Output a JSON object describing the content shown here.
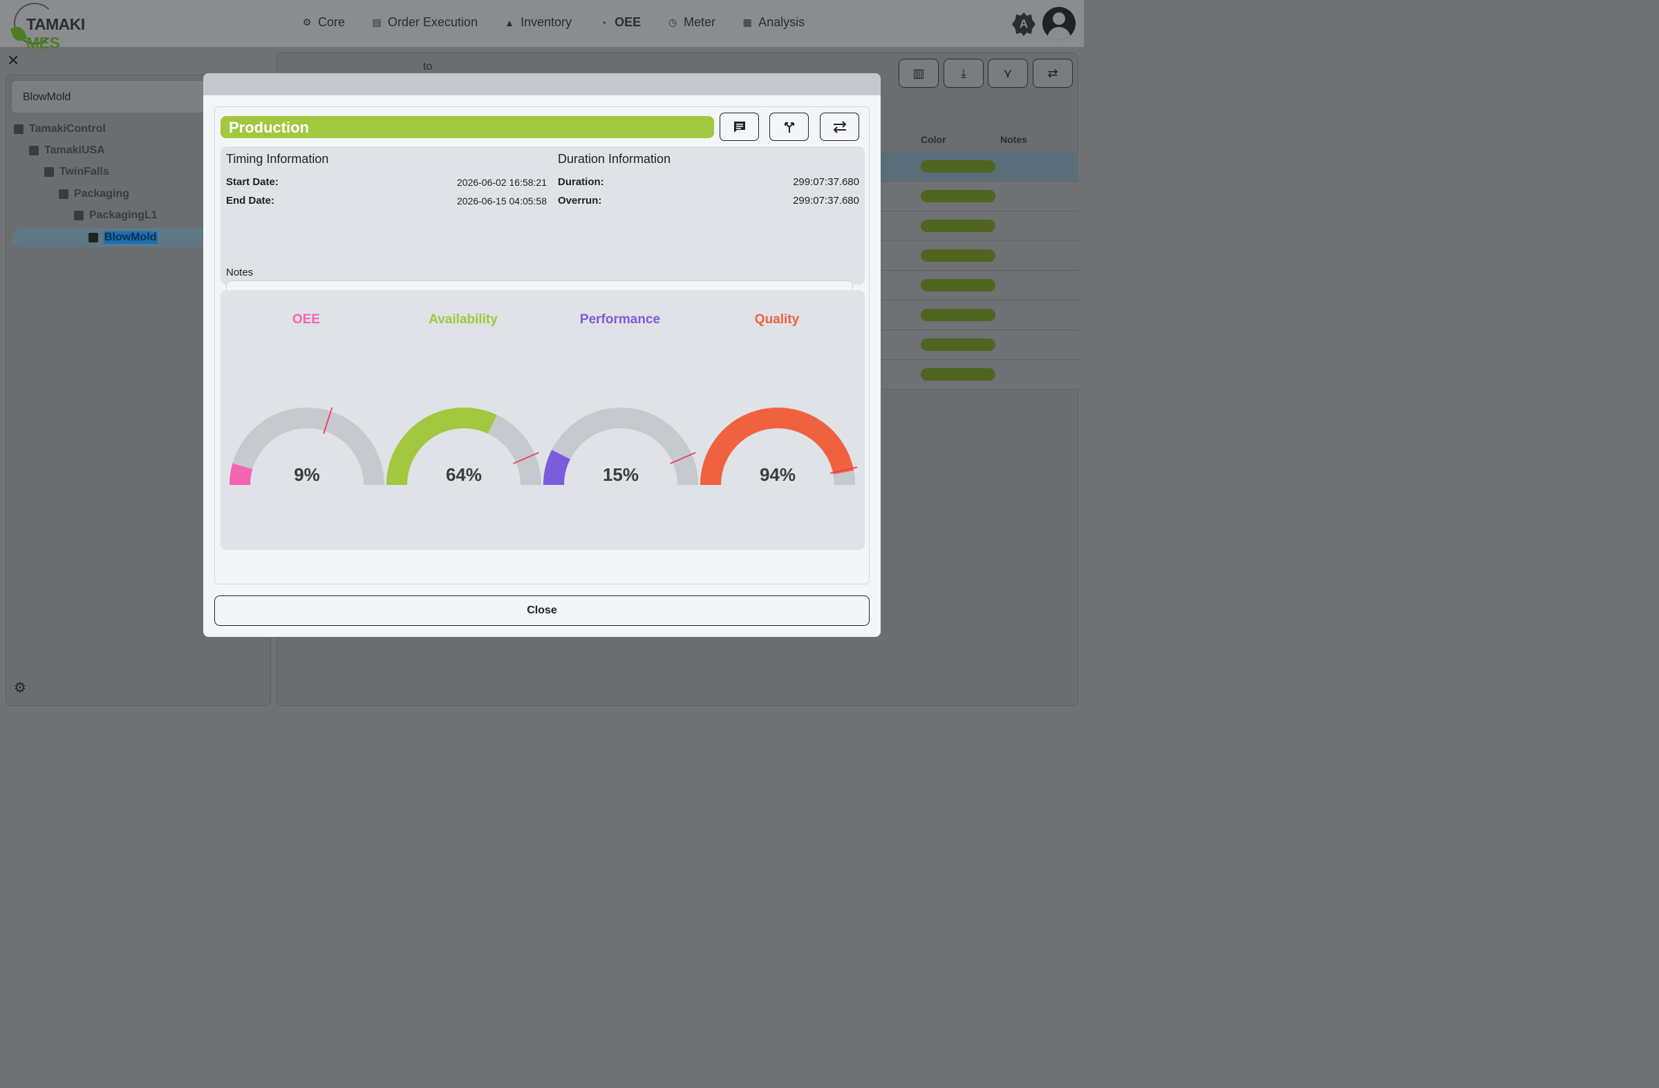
{
  "app": {
    "logo_part1": "TAMAKI",
    "logo_part2": "MES",
    "nav": [
      {
        "label": "Core",
        "icon": "gear-icon"
      },
      {
        "label": "Order Execution",
        "icon": "store-icon"
      },
      {
        "label": "Inventory",
        "icon": "shapes-icon"
      },
      {
        "label": "OEE",
        "icon": "speedometer-icon"
      },
      {
        "label": "Meter",
        "icon": "meter-icon"
      },
      {
        "label": "Analysis",
        "icon": "chart-icon"
      }
    ],
    "theme_label": "A"
  },
  "sidebar": {
    "search_value": "BlowMold",
    "tree": [
      {
        "label": "TamakiControl",
        "icon": "hierarchy-icon"
      },
      {
        "label": "TamakiUSA",
        "icon": "building-icon"
      },
      {
        "label": "TwinFalls",
        "icon": "factory-icon"
      },
      {
        "label": "Packaging",
        "icon": "grid-icon"
      },
      {
        "label": "PackagingL1",
        "icon": "line-icon"
      },
      {
        "label": "BlowMold",
        "icon": "machine-icon",
        "selected": true
      }
    ]
  },
  "background": {
    "to_label": "to",
    "table_headers": {
      "color": "Color",
      "notes": "Notes"
    },
    "row_count": 8,
    "row_pill_color": "#4f6520"
  },
  "modal": {
    "state_label": "Production",
    "state_color": "#a1c83f",
    "timing": {
      "title": "Timing Information",
      "start_label": "Start Date:",
      "start_value": "2026-06-02 16:58:21",
      "end_label": "End Date:",
      "end_value": "2026-06-15 04:05:58"
    },
    "duration": {
      "title": "Duration Information",
      "duration_label": "Duration:",
      "duration_value": "299:07:37.680",
      "overrun_label": "Overrun:",
      "overrun_value": "299:07:37.680"
    },
    "notes_label": "Notes",
    "notes_value": "",
    "close_label": "Close",
    "gauges": [
      {
        "name": "OEE",
        "value": 9,
        "target": 60,
        "color": "#f564b3"
      },
      {
        "name": "Availability",
        "value": 64,
        "target": 87,
        "color": "#a1c83f"
      },
      {
        "name": "Performance",
        "value": 15,
        "target": 87,
        "color": "#7b5cdc"
      },
      {
        "name": "Quality",
        "value": 94,
        "target": 93,
        "color": "#f0623f"
      }
    ],
    "track_color": "#c6c9ce",
    "target_marker_color": "#ef3e4f"
  }
}
